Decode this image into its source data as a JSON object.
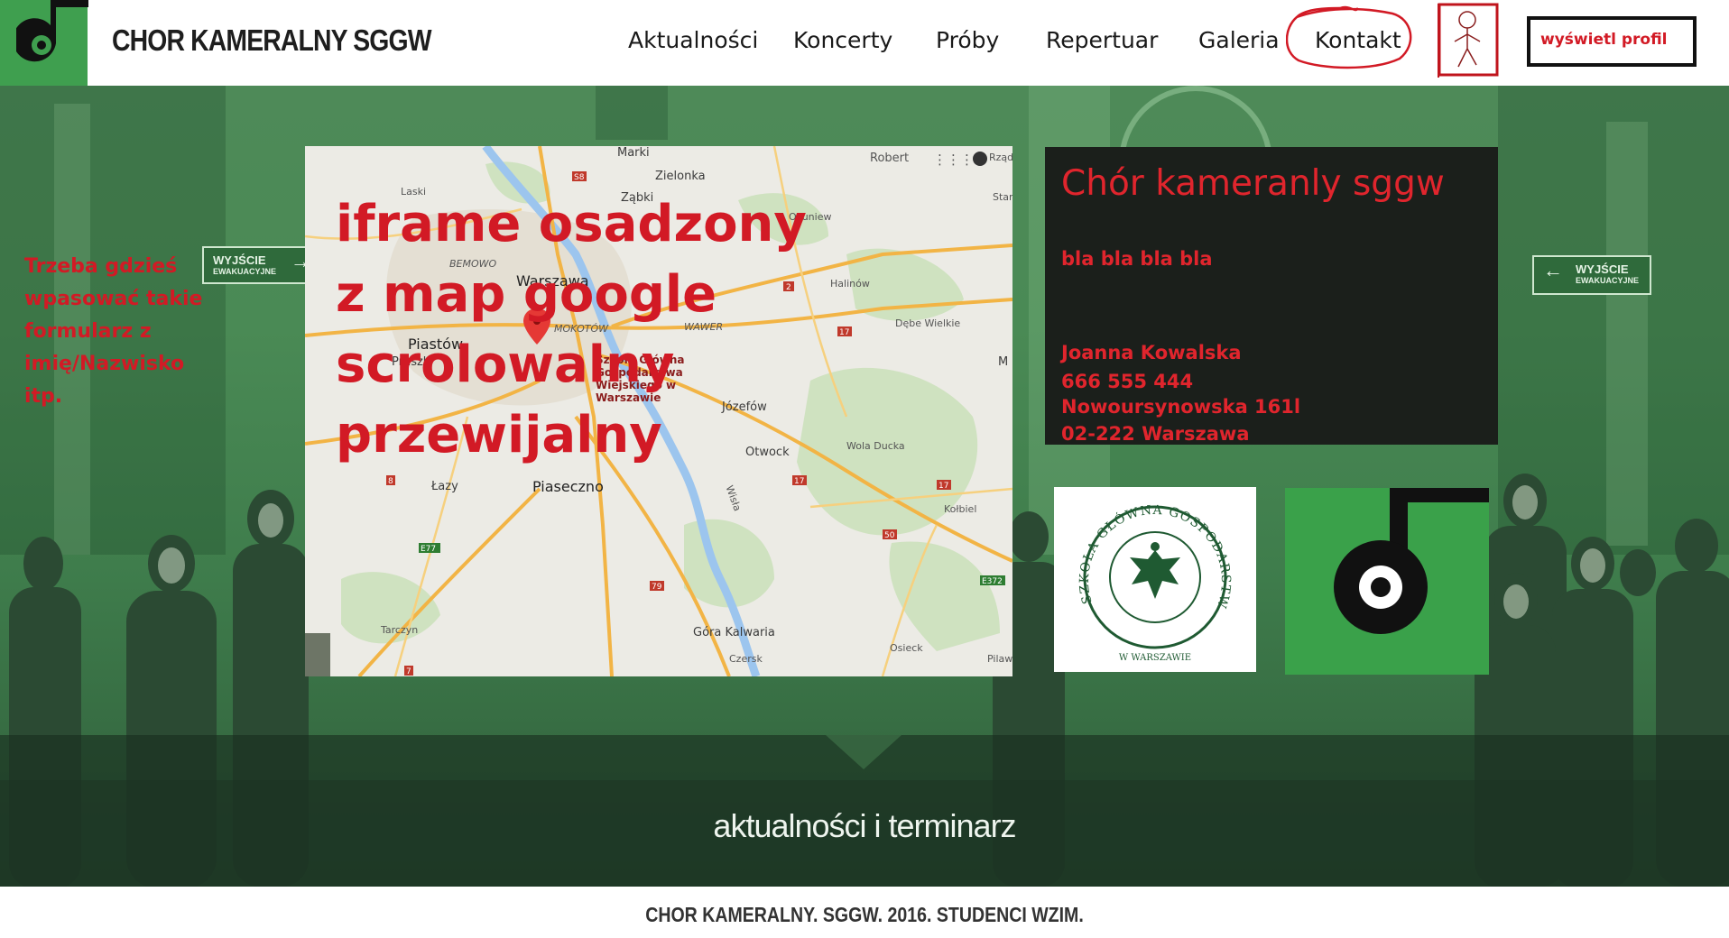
{
  "header": {
    "site_title": "CHOR KAMERALNY SGGW",
    "nav": [
      {
        "label": "Aktualności",
        "name": "nav-aktualnosci"
      },
      {
        "label": "Koncerty",
        "name": "nav-koncerty"
      },
      {
        "label": "Próby",
        "name": "nav-proby"
      },
      {
        "label": "Repertuar",
        "name": "nav-repertuar"
      },
      {
        "label": "Galeria",
        "name": "nav-galeria"
      },
      {
        "label": "Kontakt",
        "name": "nav-kontakt",
        "active": true
      }
    ],
    "profile_button": "wyświetl profil"
  },
  "hero": {
    "form_note": "Trzeba gdzieś wpasować takie formularz z imię/Nazwisko itp.",
    "exit_sign": {
      "line1": "WYJŚCIE",
      "line2": "EWAKUACYJNE"
    },
    "band_title": "aktualności i terminarz"
  },
  "map": {
    "overlay_text": "iframe osadzony z map google scrolowalny przewijalny",
    "controls": {
      "user": "Robert",
      "mode": "Rząd"
    },
    "poi": "Szkoła Główna Gospodarstwa Wiejskiego w Warszawie",
    "places": {
      "marki": "Marki",
      "zielonka": "Zielonka",
      "zabki": "Ząbki",
      "okuniew": "Okuniew",
      "stan": "Stan",
      "laski": "Laski",
      "bemowo": "BEMOWO",
      "warszawa": "Warszawa",
      "halinow": "Halinów",
      "piastow": "Piastów",
      "pruszkow": "Pruszk",
      "mokotow": "MOKOTÓW",
      "wawer": "WAWER",
      "debe": "Dębe Wielkie",
      "josefow": "Józefów",
      "otwock": "Otwock",
      "wola": "Wola Ducka",
      "lazy": "Łazy",
      "piaseczno": "Piaseczno",
      "wisla": "Wisła",
      "kolbiel": "Kołbiel",
      "tarczyn": "Tarczyn",
      "gora": "Góra Kalwaria",
      "osieck": "Osieck",
      "czersk": "Czersk",
      "pilaw": "Pilaw",
      "m": "M",
      "r_s8": "S8",
      "r_2": "2",
      "r_17": "17",
      "r_8": "8",
      "r_50": "50",
      "r_e77": "E77",
      "r_79": "79",
      "r_e372": "E372",
      "r_7": "7"
    }
  },
  "info": {
    "title": "Chór kameranly sggw",
    "text": "bla bla bla bla",
    "name": "Joanna Kowalska",
    "phone": "666 555 444",
    "street": "Nowoursynowska 161l",
    "city": "02-222 Warszawa"
  },
  "sggw_logo": {
    "ring_text": "SZKOŁA GŁÓWNA GOSPODARSTWA WIEJSKIEGO",
    "bottom_text": "W WARSZAWIE"
  },
  "footer": {
    "text": "CHOR KAMERALNY. SGGW. 2016. STUDENCI WZIM."
  },
  "colors": {
    "accent_green": "#3f9f4f",
    "annotation_red": "#d21a25",
    "panel_dark": "#1b1f1b"
  }
}
